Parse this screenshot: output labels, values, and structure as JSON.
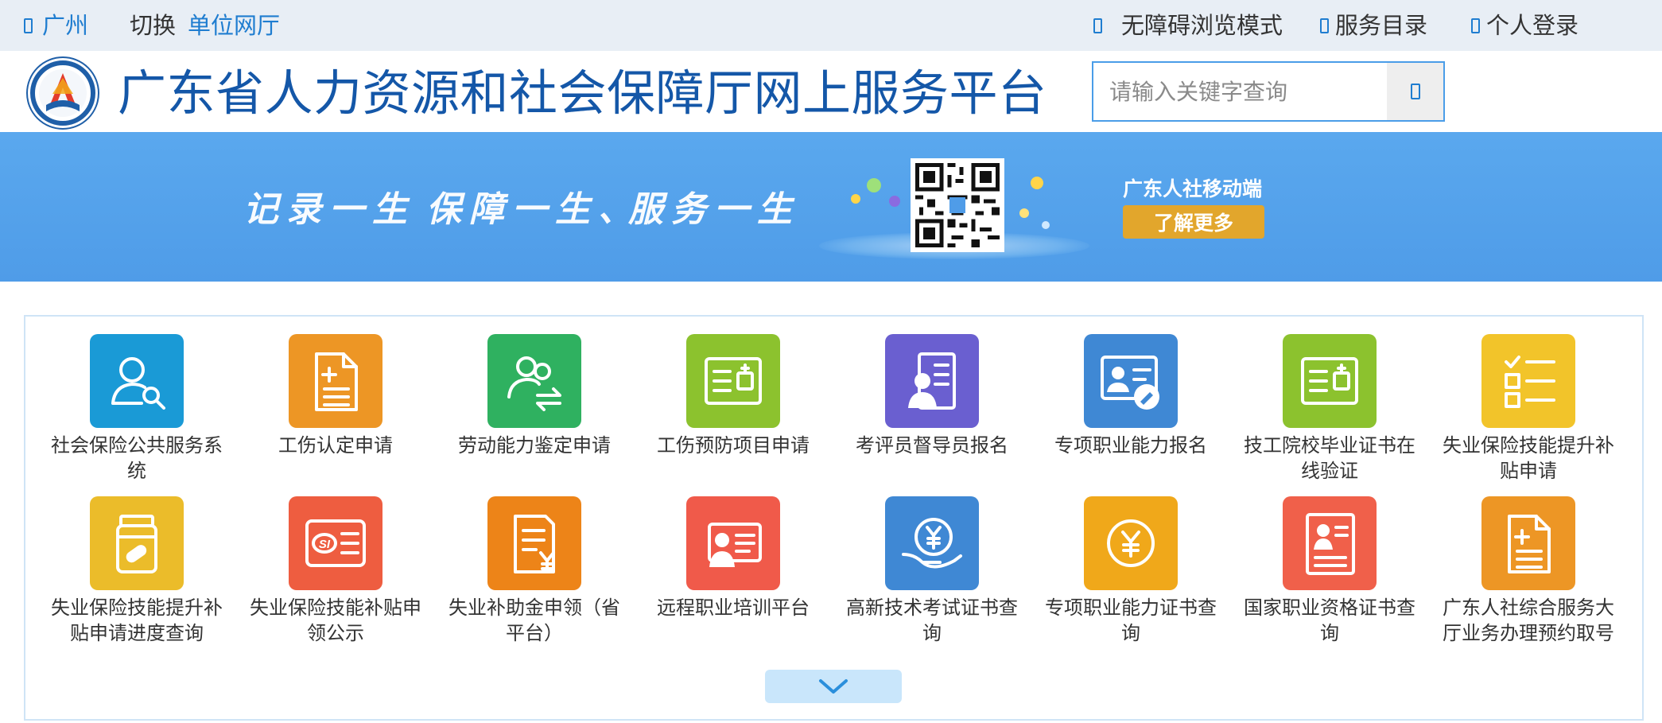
{
  "topbar": {
    "city": "广州",
    "switch_label": "切换",
    "unit_hall": "单位网厅",
    "accessibility": "无障碍浏览模式",
    "service_catalog": "服务目录",
    "personal_login": "个人登录"
  },
  "header": {
    "site_title": "广东省人力资源和社会保障厅网上服务平台",
    "search_placeholder": "请输入关键字查询"
  },
  "banner": {
    "slogan_1": "记录一生",
    "slogan_2": "保障一生、",
    "slogan_3": "服务一生",
    "mobile_title": "广东人社移动端",
    "learn_more": "了解更多"
  },
  "services": [
    {
      "label": "社会保险公共服务系统",
      "color": "#1a9ad6",
      "icon": "user-search-icon"
    },
    {
      "label": "工伤认定申请",
      "color": "#ed9625",
      "icon": "document-add-icon"
    },
    {
      "label": "劳动能力鉴定申请",
      "color": "#2fb160",
      "icon": "users-transfer-icon"
    },
    {
      "label": "工伤预防项目申请",
      "color": "#8cc22e",
      "icon": "medical-card-icon"
    },
    {
      "label": "考评员督导员报名",
      "color": "#6a5fd0",
      "icon": "profile-document-icon"
    },
    {
      "label": "专项职业能力报名",
      "color": "#3f88d4",
      "icon": "id-card-edit-icon"
    },
    {
      "label": "技工院校毕业证书在线验证",
      "color": "#8cc22e",
      "icon": "certificate-card-icon"
    },
    {
      "label": "失业保险技能提升补贴申请",
      "color": "#f2c42a",
      "icon": "checklist-icon"
    },
    {
      "label": "失业保险技能提升补贴申请进度查询",
      "color": "#ebbc2a",
      "icon": "medicine-bottle-icon"
    },
    {
      "label": "失业保险技能补贴申领公示",
      "color": "#ee5d40",
      "icon": "social-insurance-card-icon"
    },
    {
      "label": "失业补助金申领（省平台）",
      "color": "#ed8418",
      "icon": "invoice-yen-icon"
    },
    {
      "label": "远程职业培训平台",
      "color": "#f05a4a",
      "icon": "id-card-icon"
    },
    {
      "label": "高新技术考试证书查询",
      "color": "#3f88d4",
      "icon": "yen-hand-icon"
    },
    {
      "label": "专项职业能力证书查询",
      "color": "#f0a81a",
      "icon": "yen-coin-icon"
    },
    {
      "label": "国家职业资格证书查询",
      "color": "#f0604a",
      "icon": "person-certificate-icon"
    },
    {
      "label": "广东人社综合服务大厅业务办理预约取号",
      "color": "#ed9625",
      "icon": "document-add-icon"
    }
  ],
  "colors": {
    "topbar_bg": "#e8eef5",
    "link_blue": "#1f7dd0",
    "title_blue": "#1457a8",
    "banner_blue": "#4f9ce8",
    "gold": "#e2a62c"
  }
}
